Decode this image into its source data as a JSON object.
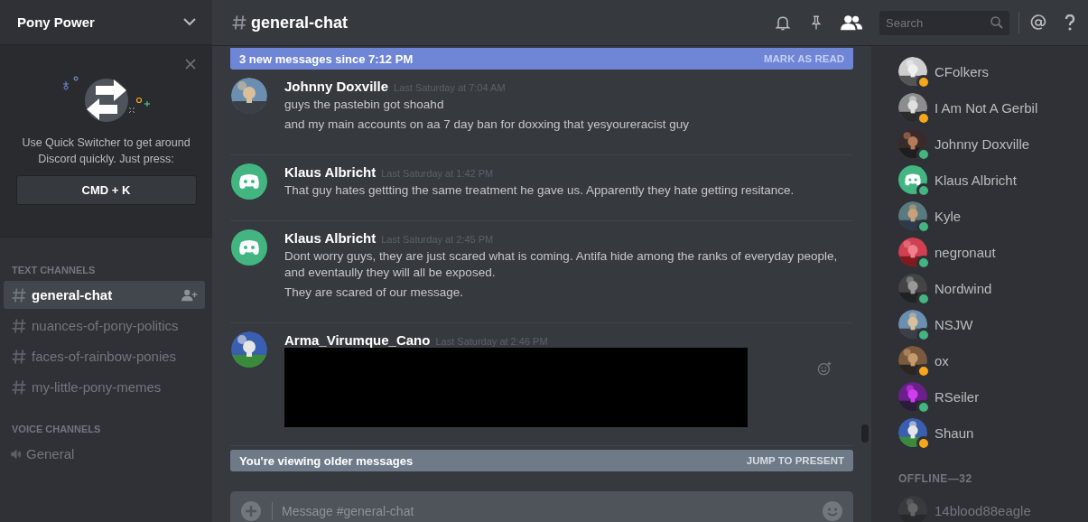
{
  "server": {
    "name": "Pony Power"
  },
  "quick_switcher": {
    "text": "Use Quick Switcher to get around Discord quickly. Just press:",
    "shortcut": "CMD + K"
  },
  "channel_groups": [
    {
      "title": "TEXT CHANNELS",
      "kind": "text",
      "channels": [
        {
          "name": "general-chat",
          "selected": true
        },
        {
          "name": "nuances-of-pony-politics",
          "selected": false
        },
        {
          "name": "faces-of-rainbow-ponies",
          "selected": false
        },
        {
          "name": "my-little-pony-memes",
          "selected": false
        }
      ]
    },
    {
      "title": "VOICE CHANNELS",
      "kind": "voice",
      "channels": [
        {
          "name": "General",
          "selected": false
        }
      ]
    }
  ],
  "channel_header": {
    "name": "general-chat"
  },
  "search": {
    "placeholder": "Search"
  },
  "new_messages_bar": {
    "text": "3 new messages since 7:12 PM",
    "action": "MARK AS READ"
  },
  "messages": [
    {
      "author": "Johnny Doxville",
      "kind": "picture",
      "timestamp": "Last Saturday at 7:04 AM",
      "lines": [
        "guys the pastebin got shoahd",
        "and my main accounts on aa 7 day ban for doxxing that yesyoureracist guy"
      ]
    },
    {
      "author": "Klaus Albricht",
      "kind": "default",
      "timestamp": "Last Saturday at 1:42 PM",
      "lines": [
        "That guy hates gettting the same treatment he gave us. Apparently they hate getting resitance."
      ]
    },
    {
      "author": "Klaus Albricht",
      "kind": "default",
      "timestamp": "Last Saturday at 2:45 PM",
      "lines": [
        "Dont worry guys, they are just scared what is coming. Antifa hide among the ranks of everyday people, and eventaully they will all be exposed.",
        "They are scared of our message."
      ]
    },
    {
      "author": "Arma_Virumque_Cano",
      "kind": "picture",
      "timestamp": "Last Saturday at 2:46 PM",
      "redacted": true,
      "hovered": true
    }
  ],
  "older_messages_bar": {
    "text": "You're viewing older messages",
    "action": "JUMP TO PRESENT"
  },
  "composer": {
    "placeholder": "Message #general-chat"
  },
  "members": [
    {
      "name": "CFolkers",
      "kind": "picture",
      "color": "#faa61a"
    },
    {
      "name": "I Am Not A Gerbil",
      "kind": "picture",
      "color": "#faa61a"
    },
    {
      "name": "Johnny Doxville",
      "kind": "picture",
      "color": "#43b581"
    },
    {
      "name": "Klaus Albricht",
      "kind": "default",
      "color": "#43b581"
    },
    {
      "name": "Kyle",
      "kind": "picture",
      "color": "#43b581"
    },
    {
      "name": "negronaut",
      "kind": "picture",
      "color": "#43b581"
    },
    {
      "name": "Nordwind",
      "kind": "picture",
      "color": "#43b581"
    },
    {
      "name": "NSJW",
      "kind": "picture",
      "color": "#43b581"
    },
    {
      "name": "ox",
      "kind": "picture",
      "color": "#faa61a"
    },
    {
      "name": "RSeiler",
      "kind": "picture",
      "color": "#43b581"
    },
    {
      "name": "Shaun",
      "kind": "picture",
      "color": "#faa61a"
    }
  ],
  "offline": {
    "title": "OFFLINE—32",
    "members": [
      {
        "name": "14blood88eagle",
        "kind": "picture"
      }
    ]
  }
}
